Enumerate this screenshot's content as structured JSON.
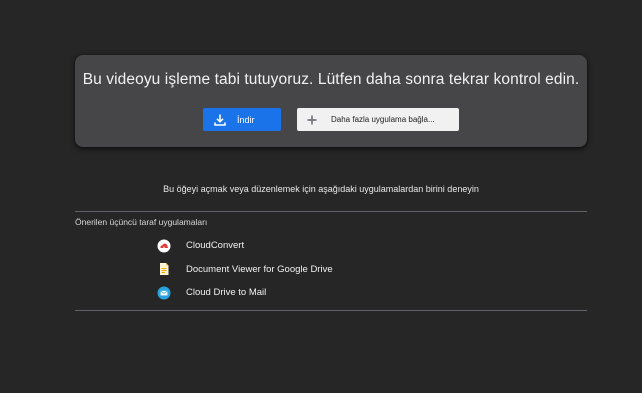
{
  "notice": {
    "message": "Bu videoyu işleme tabi tutuyoruz. Lütfen daha sonra tekrar kontrol edin.",
    "download_button": {
      "label": "İndir",
      "icon": "download-icon"
    },
    "connect_button": {
      "label": "Daha fazla uygulama bağla...",
      "icon": "plus-icon"
    }
  },
  "hint": "Bu öğeyi açmak veya düzenlemek için aşağıdaki uygulamalardan birini deneyin",
  "suggested": {
    "title": "Önerilen üçüncü taraf uygulamaları",
    "apps": [
      {
        "name": "CloudConvert",
        "icon": "cloudconvert-icon"
      },
      {
        "name": "Document Viewer for Google Drive",
        "icon": "document-viewer-icon"
      },
      {
        "name": "Cloud Drive to Mail",
        "icon": "mail-icon"
      }
    ]
  },
  "colors": {
    "background": "#262626",
    "card": "#464648",
    "primary": "#1a73e8",
    "secondary_button": "#f1f1f1"
  }
}
